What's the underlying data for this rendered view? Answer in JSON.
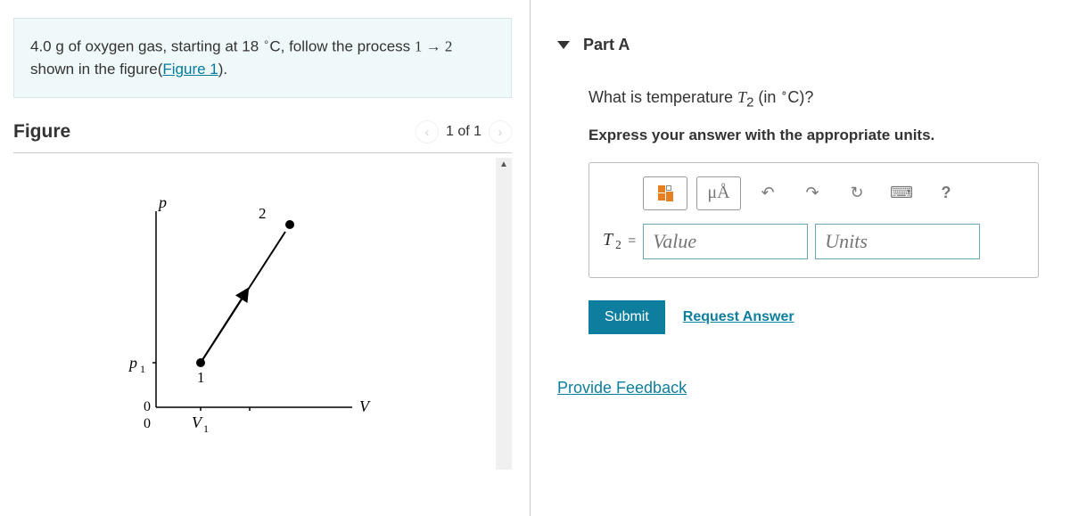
{
  "problem": {
    "mass": "4.0",
    "mass_unit": "g",
    "gas": "oxygen gas",
    "start_temp": "18",
    "temp_unit_deg": "∘",
    "temp_unit_c": "C",
    "process_from": "1",
    "process_to": "2",
    "figure_link_text": "Figure 1"
  },
  "figure": {
    "title": "Figure",
    "nav_counter": "1 of 1",
    "axis_y": "p",
    "axis_x": "V",
    "y_tick_p1": "p",
    "y_tick_p1_sub": "1",
    "y_zero": "0",
    "x_zero": "0",
    "x_tick_v1": "V",
    "x_tick_v1_sub": "1",
    "point1_label": "1",
    "point2_label": "2"
  },
  "part": {
    "label": "Part A",
    "question_prefix": "What is temperature ",
    "question_var": "T",
    "question_sub": "2",
    "question_suffix_open": " (in ",
    "question_suffix_close": ")?",
    "instruction": "Express your answer with the appropriate units.",
    "toolbar": {
      "mu_a": "μÅ",
      "undo": "↶",
      "redo": "↷",
      "reset": "↻",
      "keyboard": "⌨",
      "help": "?"
    },
    "input": {
      "var": "T",
      "sub": "2",
      "equals": "=",
      "value_placeholder": "Value",
      "units_placeholder": "Units"
    },
    "submit": "Submit",
    "request_answer": "Request Answer"
  },
  "feedback_link": "Provide Feedback"
}
